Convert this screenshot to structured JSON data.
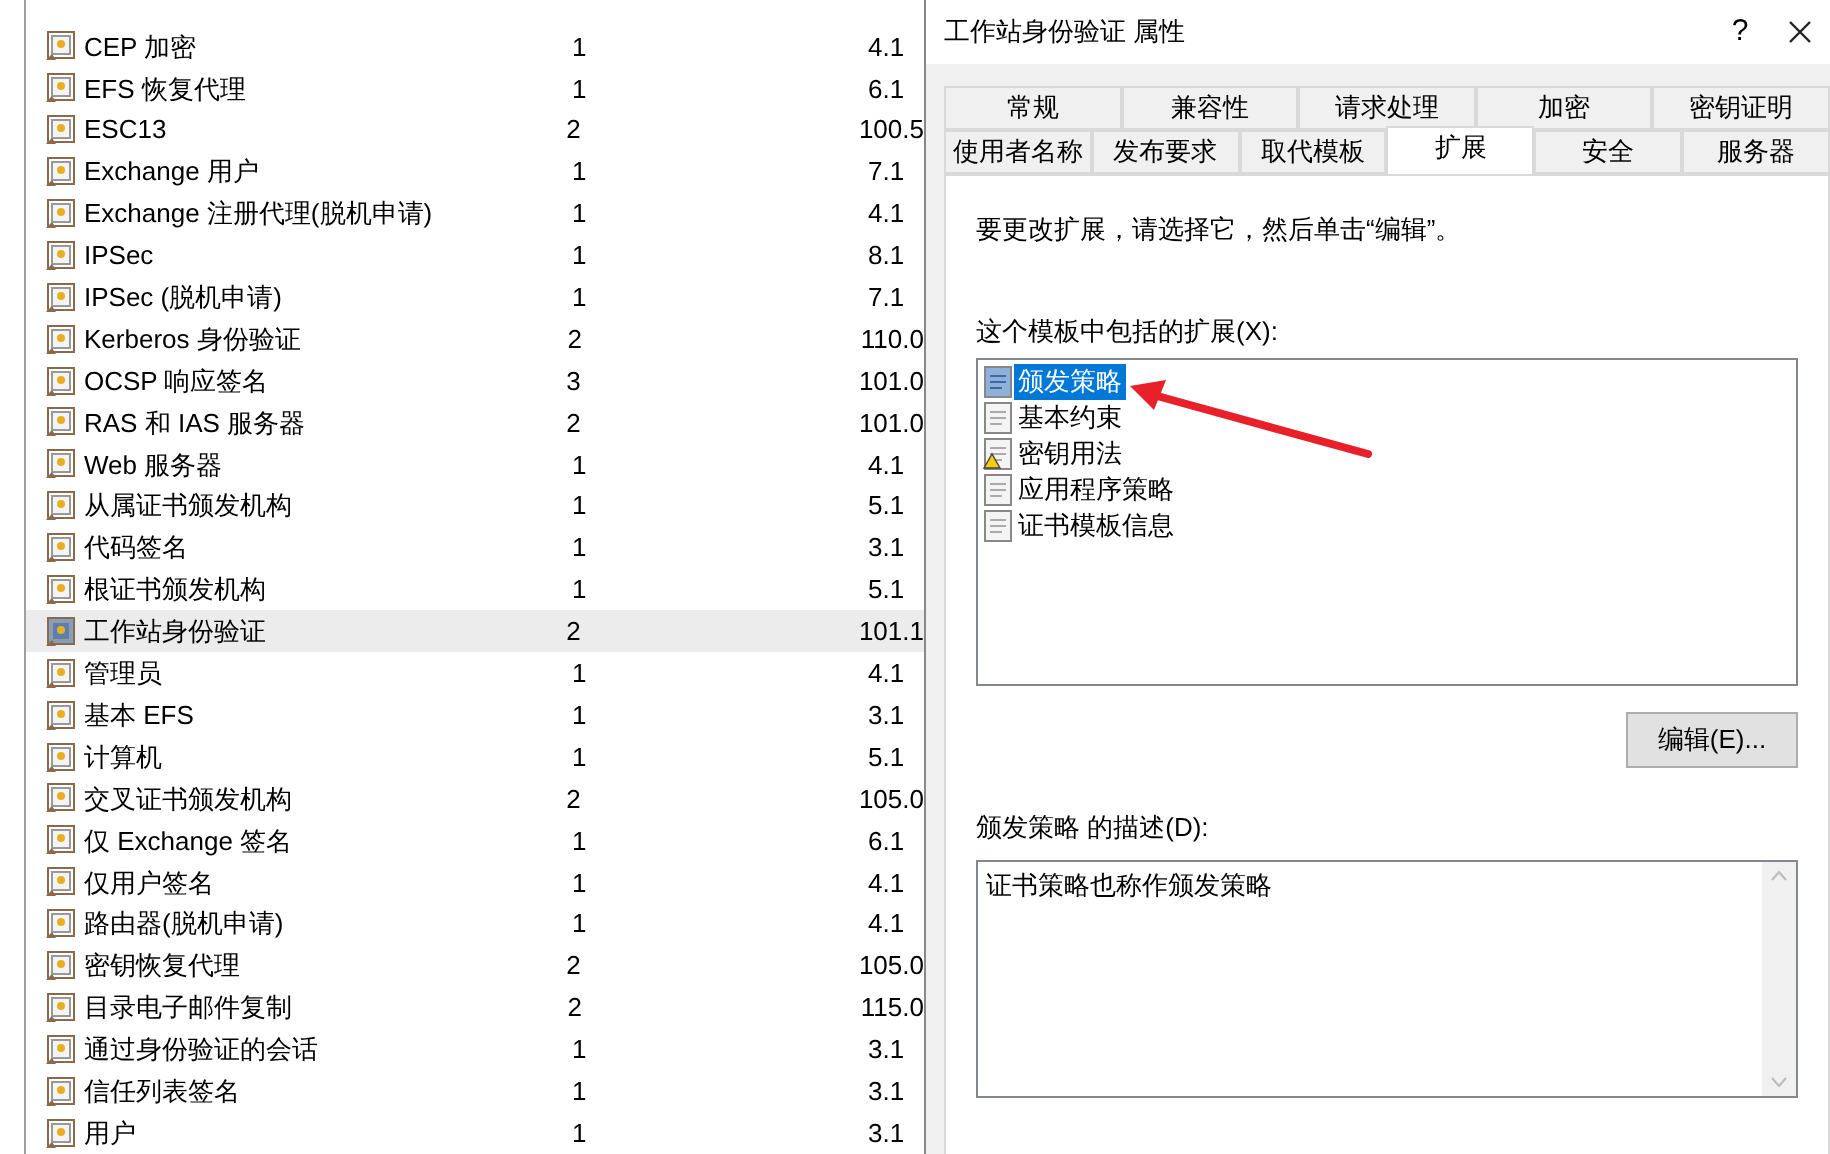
{
  "templates": [
    {
      "name": "CEP 加密",
      "schema": "1",
      "version": "4.1",
      "selected": false
    },
    {
      "name": "EFS 恢复代理",
      "schema": "1",
      "version": "6.1",
      "selected": false
    },
    {
      "name": "ESC13",
      "schema": "2",
      "version": "100.5",
      "selected": false
    },
    {
      "name": "Exchange 用户",
      "schema": "1",
      "version": "7.1",
      "selected": false
    },
    {
      "name": "Exchange 注册代理(脱机申请)",
      "schema": "1",
      "version": "4.1",
      "selected": false
    },
    {
      "name": "IPSec",
      "schema": "1",
      "version": "8.1",
      "selected": false
    },
    {
      "name": "IPSec (脱机申请)",
      "schema": "1",
      "version": "7.1",
      "selected": false
    },
    {
      "name": "Kerberos 身份验证",
      "schema": "2",
      "version": "110.0",
      "selected": false
    },
    {
      "name": "OCSP 响应签名",
      "schema": "3",
      "version": "101.0",
      "selected": false
    },
    {
      "name": "RAS 和 IAS 服务器",
      "schema": "2",
      "version": "101.0",
      "selected": false
    },
    {
      "name": "Web 服务器",
      "schema": "1",
      "version": "4.1",
      "selected": false
    },
    {
      "name": "从属证书颁发机构",
      "schema": "1",
      "version": "5.1",
      "selected": false
    },
    {
      "name": "代码签名",
      "schema": "1",
      "version": "3.1",
      "selected": false
    },
    {
      "name": "根证书颁发机构",
      "schema": "1",
      "version": "5.1",
      "selected": false
    },
    {
      "name": "工作站身份验证",
      "schema": "2",
      "version": "101.1",
      "selected": true
    },
    {
      "name": "管理员",
      "schema": "1",
      "version": "4.1",
      "selected": false
    },
    {
      "name": "基本 EFS",
      "schema": "1",
      "version": "3.1",
      "selected": false
    },
    {
      "name": "计算机",
      "schema": "1",
      "version": "5.1",
      "selected": false
    },
    {
      "name": "交叉证书颁发机构",
      "schema": "2",
      "version": "105.0",
      "selected": false
    },
    {
      "name": "仅 Exchange 签名",
      "schema": "1",
      "version": "6.1",
      "selected": false
    },
    {
      "name": "仅用户签名",
      "schema": "1",
      "version": "4.1",
      "selected": false
    },
    {
      "name": "路由器(脱机申请)",
      "schema": "1",
      "version": "4.1",
      "selected": false
    },
    {
      "name": "密钥恢复代理",
      "schema": "2",
      "version": "105.0",
      "selected": false
    },
    {
      "name": "目录电子邮件复制",
      "schema": "2",
      "version": "115.0",
      "selected": false
    },
    {
      "name": "通过身份验证的会话",
      "schema": "1",
      "version": "3.1",
      "selected": false
    },
    {
      "name": "信任列表签名",
      "schema": "1",
      "version": "3.1",
      "selected": false
    },
    {
      "name": "用户",
      "schema": "1",
      "version": "3.1",
      "selected": false
    }
  ],
  "dialog": {
    "title": "工作站身份验证 属性",
    "help": "?",
    "tab_rows": [
      [
        {
          "label": "常规",
          "selected": false
        },
        {
          "label": "兼容性",
          "selected": false
        },
        {
          "label": "请求处理",
          "selected": false
        },
        {
          "label": "加密",
          "selected": false
        },
        {
          "label": "密钥证明",
          "selected": false
        }
      ],
      [
        {
          "label": "使用者名称",
          "selected": false
        },
        {
          "label": "发布要求",
          "selected": false
        },
        {
          "label": "取代模板",
          "selected": false
        },
        {
          "label": "扩展",
          "selected": true
        },
        {
          "label": "安全",
          "selected": false
        },
        {
          "label": "服务器",
          "selected": false
        }
      ]
    ],
    "instruction": "要更改扩展，请选择它，然后单击“编辑”。",
    "extensions_label": "这个模板中包括的扩展(X):",
    "extensions": [
      {
        "name": "颁发策略",
        "kind": "normal",
        "selected": true
      },
      {
        "name": "基本约束",
        "kind": "normal",
        "selected": false
      },
      {
        "name": "密钥用法",
        "kind": "warning",
        "selected": false
      },
      {
        "name": "应用程序策略",
        "kind": "normal",
        "selected": false
      },
      {
        "name": "证书模板信息",
        "kind": "normal",
        "selected": false
      }
    ],
    "edit_button": "编辑(E)...",
    "description_label": "颁发策略 的描述(D):",
    "description": "证书策略也称作颁发策略"
  }
}
